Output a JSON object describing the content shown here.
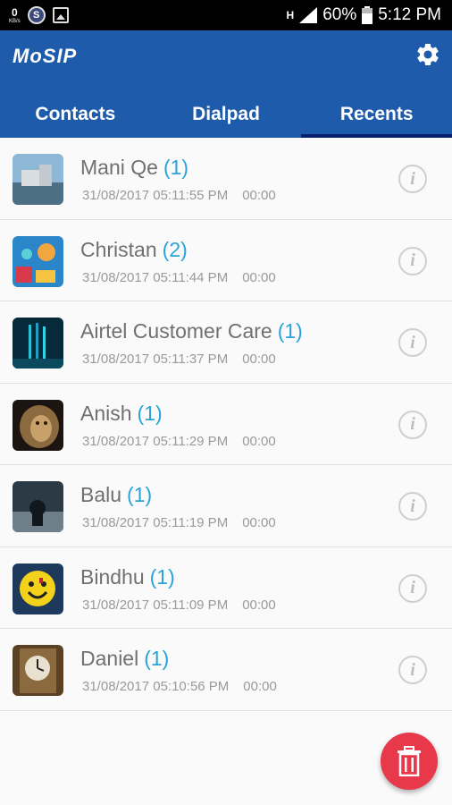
{
  "status_bar": {
    "speed_value": "0",
    "speed_unit": "KB/s",
    "s_badge": "S",
    "network": "H",
    "battery": "60%",
    "time": "5:12 PM"
  },
  "app": {
    "title": "MoSIP"
  },
  "tabs": [
    {
      "label": "Contacts"
    },
    {
      "label": "Dialpad"
    },
    {
      "label": "Recents",
      "active": true
    }
  ],
  "recents": [
    {
      "name": "Mani Qe",
      "count": "(1)",
      "datetime": "31/08/2017 05:11:55 PM",
      "duration": "00:00"
    },
    {
      "name": "Christan",
      "count": "(2)",
      "datetime": "31/08/2017 05:11:44 PM",
      "duration": "00:00"
    },
    {
      "name": "Airtel Customer Care",
      "count": "(1)",
      "datetime": "31/08/2017 05:11:37 PM",
      "duration": "00:00"
    },
    {
      "name": "Anish",
      "count": "(1)",
      "datetime": "31/08/2017 05:11:29 PM",
      "duration": "00:00"
    },
    {
      "name": "Balu",
      "count": "(1)",
      "datetime": "31/08/2017 05:11:19 PM",
      "duration": "00:00"
    },
    {
      "name": "Bindhu",
      "count": "(1)",
      "datetime": "31/08/2017 05:11:09 PM",
      "duration": "00:00"
    },
    {
      "name": "Daniel",
      "count": "(1)",
      "datetime": "31/08/2017 05:10:56 PM",
      "duration": "00:00"
    }
  ],
  "info_glyph": "i",
  "colors": {
    "primary": "#1f5bab",
    "tab_indicator": "#0a1f6b",
    "count": "#29a3d8",
    "fab": "#e8394a"
  },
  "icons": {
    "settings": "gear-icon",
    "info": "info-icon",
    "delete": "trash-icon"
  }
}
